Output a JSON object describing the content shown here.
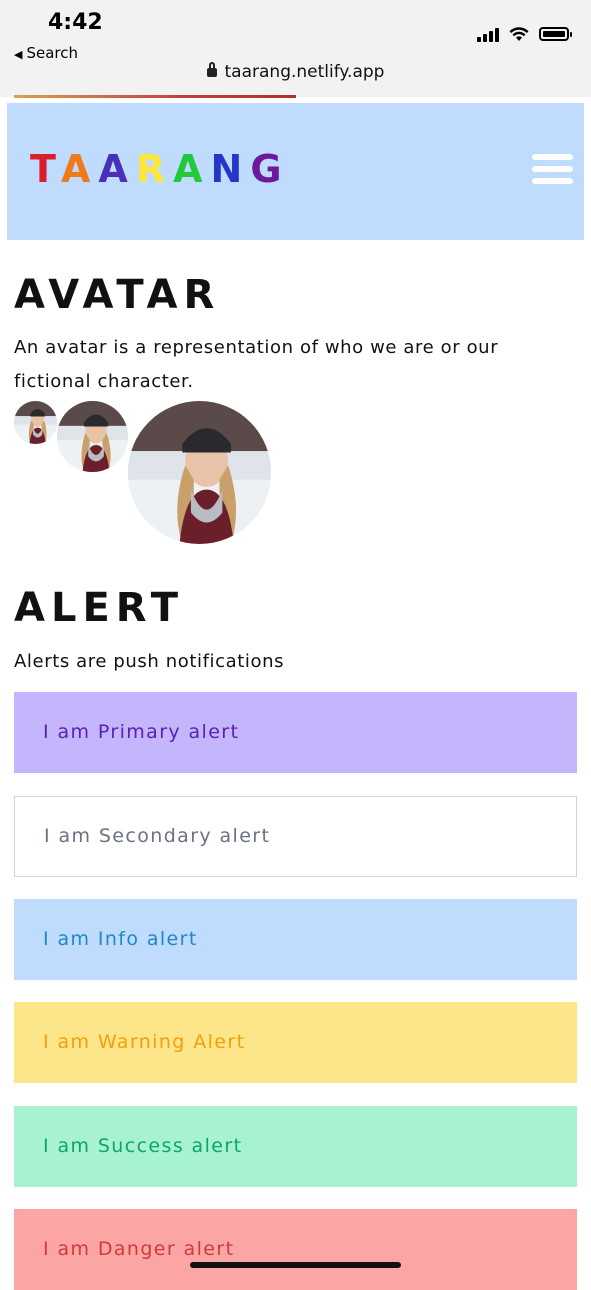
{
  "status": {
    "time": "4:42",
    "back_label": "Search",
    "url": "taarang.netlify.app"
  },
  "header": {
    "logo_letters": [
      "T",
      "A",
      "A",
      "R",
      "A",
      "N",
      "G"
    ],
    "menu_icon": "hamburger-icon"
  },
  "avatar_section": {
    "title": "AVATAR",
    "description": "An avatar is a representation of who we are or our fictional character."
  },
  "alert_section": {
    "title": "ALERT",
    "description": "Alerts are push notifications",
    "alerts": [
      {
        "label": "I am Primary alert"
      },
      {
        "label": "I am Secondary alert"
      },
      {
        "label": "I am Info alert"
      },
      {
        "label": "I am Warning Alert"
      },
      {
        "label": "I am Success alert"
      },
      {
        "label": "I am Danger alert"
      }
    ]
  },
  "colors": {
    "header_bg": "#bfdbfe",
    "primary_bg": "#c4b5fd",
    "info_bg": "#bfdbfe",
    "warning_bg": "#fde68a",
    "success_bg": "#a7f3d0",
    "danger_bg": "#fca5a5"
  }
}
